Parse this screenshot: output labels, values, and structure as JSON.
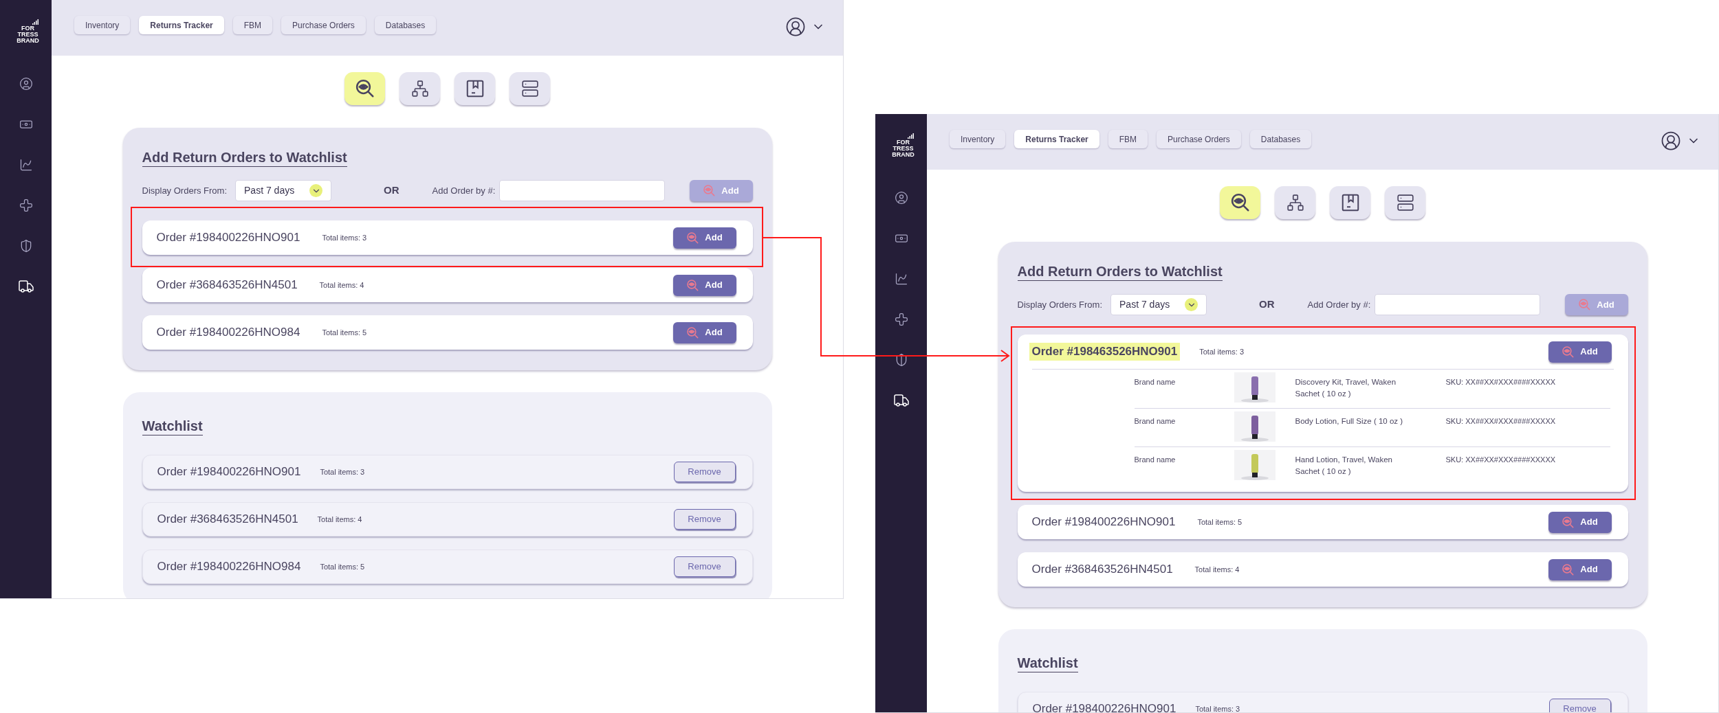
{
  "screens": [
    {
      "logo": "FOR TRESS BRAND",
      "sidebar_items": [
        {
          "selected": false
        },
        {
          "selected": false
        },
        {
          "selected": false
        },
        {
          "selected": false
        },
        {
          "selected": false
        },
        {
          "selected": true
        }
      ],
      "nav_tabs": [
        {
          "label": "Inventory",
          "selected": false
        },
        {
          "label": "Returns Tracker",
          "selected": true
        },
        {
          "label": "FBM",
          "selected": false
        },
        {
          "label": "Purchase Orders",
          "selected": false
        },
        {
          "label": "Databases",
          "selected": false
        }
      ],
      "view_buttons": [
        {
          "selected": true
        },
        {
          "selected": false
        },
        {
          "selected": false
        },
        {
          "selected": false
        }
      ],
      "add_section": {
        "title": "Add Return Orders to Watchlist",
        "filter_label": "Display Orders From:",
        "filter_value": "Past 7 days",
        "or_label": "OR",
        "add_by_label": "Add Order by #:",
        "add_button": {
          "label": "Add",
          "disabled": true
        },
        "orders": [
          {
            "number": "Order #198400226HNO901",
            "total": "Total items: 3",
            "button": "Add",
            "highlighted": false,
            "expanded": false
          },
          {
            "number": "Order #368463526HN4501",
            "total": "Total items: 4",
            "button": "Add",
            "highlighted": false,
            "expanded": false
          },
          {
            "number": "Order #198400226HNO984",
            "total": "Total items: 5",
            "button": "Add",
            "highlighted": false,
            "expanded": false
          }
        ]
      },
      "watchlist": {
        "title": "Watchlist",
        "orders": [
          {
            "number": "Order #198400226HNO901",
            "total": "Total items: 3",
            "button": "Remove"
          },
          {
            "number": "Order #368463526HN4501",
            "total": "Total items: 4",
            "button": "Remove"
          },
          {
            "number": "Order #198400226HNO984",
            "total": "Total items: 5",
            "button": "Remove"
          }
        ]
      }
    },
    {
      "logo": "FOR TRESS BRAND",
      "sidebar_items": [
        {
          "selected": false
        },
        {
          "selected": false
        },
        {
          "selected": false
        },
        {
          "selected": false
        },
        {
          "selected": false
        },
        {
          "selected": true
        }
      ],
      "nav_tabs": [
        {
          "label": "Inventory",
          "selected": false
        },
        {
          "label": "Returns Tracker",
          "selected": true
        },
        {
          "label": "FBM",
          "selected": false
        },
        {
          "label": "Purchase Orders",
          "selected": false
        },
        {
          "label": "Databases",
          "selected": false
        }
      ],
      "view_buttons": [
        {
          "selected": true
        },
        {
          "selected": false
        },
        {
          "selected": false
        },
        {
          "selected": false
        }
      ],
      "add_section": {
        "title": "Add Return Orders to Watchlist",
        "filter_label": "Display Orders From:",
        "filter_value": "Past 7 days",
        "or_label": "OR",
        "add_by_label": "Add Order by #:",
        "add_button": {
          "label": "Add",
          "disabled": true
        },
        "orders": [
          {
            "number": "Order #198463526HNO901",
            "total": "Total items: 3",
            "button": "Add",
            "highlighted": true,
            "expanded": true,
            "items": [
              {
                "brand": "Brand name",
                "description": "Discovery Kit, Travel, Waken Sachet ( 10 oz )",
                "sku": "SKU: XX##XX#XXX####XXXXX",
                "color": "#8a6fae"
              },
              {
                "brand": "Brand name",
                "description": "Body Lotion, Full Size ( 10 oz )",
                "sku": "SKU: XX##XX#XXX####XXXXX",
                "color": "#7d5f9e"
              },
              {
                "brand": "Brand name",
                "description": "Hand Lotion, Travel, Waken Sachet ( 10 oz )",
                "sku": "SKU: XX##XX#XXX####XXXXX",
                "color": "#c3c95a"
              }
            ]
          },
          {
            "number": "Order #198400226HNO901",
            "total": "Total items: 5",
            "button": "Add",
            "highlighted": false,
            "expanded": false
          },
          {
            "number": "Order #368463526HN4501",
            "total": "Total items: 4",
            "button": "Add",
            "highlighted": false,
            "expanded": false
          }
        ]
      },
      "watchlist": {
        "title": "Watchlist",
        "orders": [
          {
            "number": "Order #198400226HNO901",
            "total": "Total items: 3",
            "button": "Remove"
          }
        ]
      }
    }
  ]
}
